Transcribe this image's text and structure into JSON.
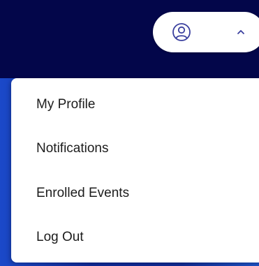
{
  "header": {
    "user_menu": {
      "user_icon": "user-circle-icon",
      "toggle_icon": "chevron-up-icon",
      "expanded": true
    }
  },
  "dropdown": {
    "items": [
      {
        "label": "My Profile"
      },
      {
        "label": "Notifications"
      },
      {
        "label": "Enrolled Events"
      },
      {
        "label": "Log Out"
      }
    ]
  },
  "colors": {
    "header_background": "#03064a",
    "page_background": "#1a2f8f",
    "menu_background": "#ffffff",
    "menu_text": "#1c1c1c",
    "icon_stroke": "#3a3f9e"
  }
}
